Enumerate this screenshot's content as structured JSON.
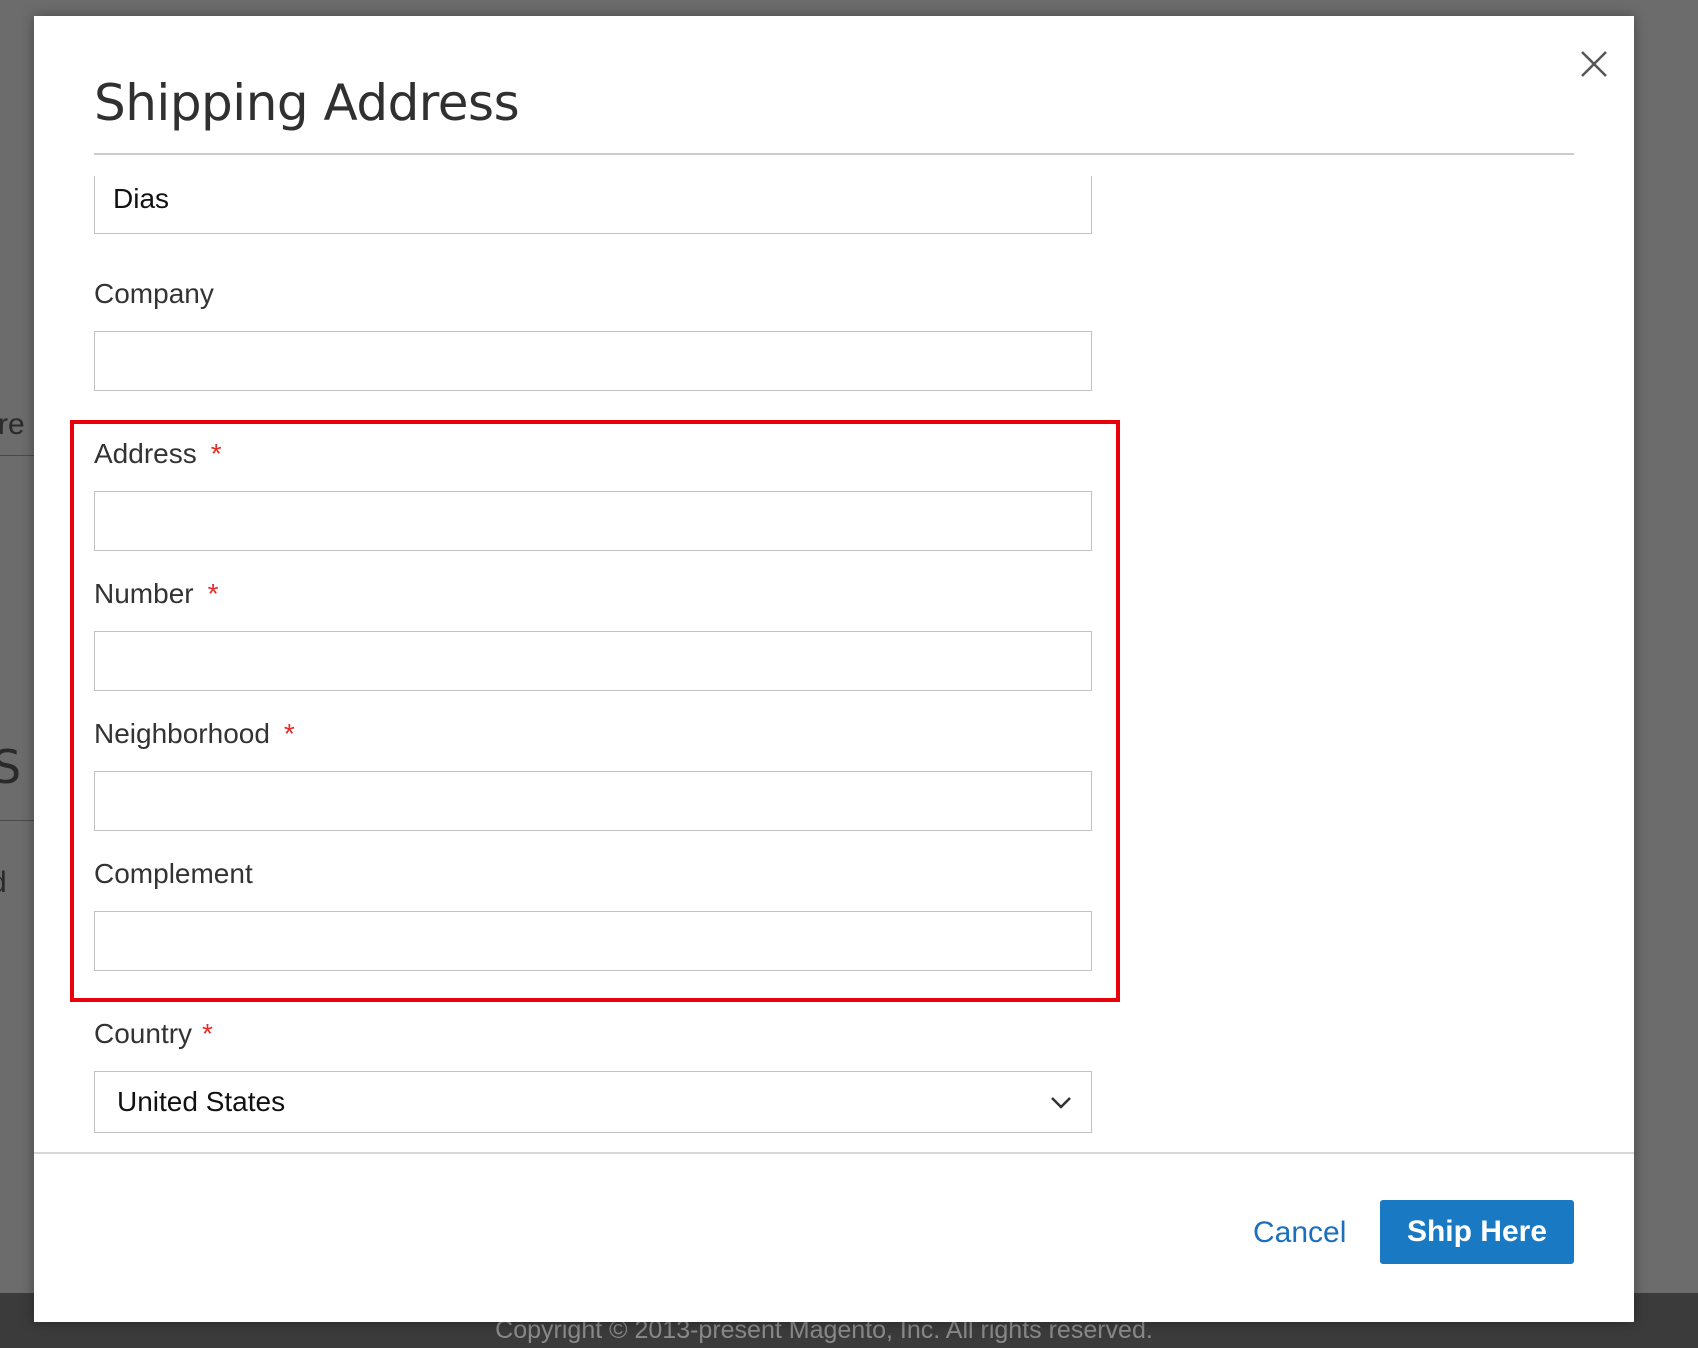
{
  "background": {
    "fragment_1": "re",
    "fragment_2": "S",
    "fragment_3": "d",
    "copyright": "Copyright © 2013-present Magento, Inc. All rights reserved."
  },
  "modal": {
    "title": "Shipping Address",
    "close_icon": "close-icon"
  },
  "form": {
    "last_name": {
      "value": "Dias"
    },
    "company": {
      "label": "Company",
      "value": ""
    },
    "address": {
      "label": "Address",
      "required_mark": "*",
      "value": ""
    },
    "number": {
      "label": "Number",
      "required_mark": "*",
      "value": ""
    },
    "neighborhood": {
      "label": "Neighborhood",
      "required_mark": "*",
      "value": ""
    },
    "complement": {
      "label": "Complement",
      "value": ""
    },
    "country": {
      "label": "Country",
      "required_mark": "*",
      "selected": "United States",
      "icon": "chevron-down-icon"
    }
  },
  "actions": {
    "cancel_label": "Cancel",
    "ship_label": "Ship Here"
  },
  "colors": {
    "primary": "#1979c3",
    "link": "#1a6fbf",
    "required": "#e02b27",
    "highlight": "#e8000b"
  }
}
